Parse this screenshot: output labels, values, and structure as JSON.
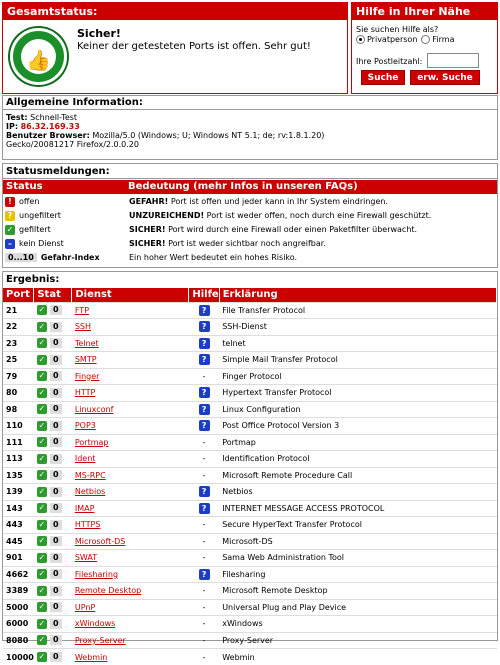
{
  "gesamtstatus": {
    "title": "Gesamtstatus:",
    "heading": "Sicher!",
    "message": "Keiner der getesteten Ports ist offen. Sehr gut!"
  },
  "hilfe": {
    "title": "Hilfe in Ihrer Nähe",
    "question": "Sie suchen Hilfe als?",
    "option_private": "Privatperson",
    "option_company": "Firma",
    "plz_label": "Ihre Postleitzahl:",
    "plz_value": "",
    "search_button": "Suche",
    "extended_button": "erw. Suche"
  },
  "info": {
    "title": "Allgemeine Information:",
    "test_label": "Test:",
    "test_value": "Schnell-Test",
    "ip_label": "IP:",
    "ip_value": "86.32.169.33",
    "browser_label": "Benutzer Browser:",
    "browser_value": "Mozilla/5.0 (Windows; U; Windows NT 5.1; de; rv:1.8.1.20)",
    "browser_value2": "Gecko/20081217 Firefox/2.0.0.20"
  },
  "statusmeldungen": {
    "title": "Statusmeldungen:",
    "col_status": "Status",
    "col_bedeutung": "Bedeutung (mehr Infos in unseren FAQs)",
    "rows": [
      {
        "label": "offen",
        "strong": "GEFAHR!",
        "text": "Port ist offen und jeder kann in Ihr System eindringen."
      },
      {
        "label": "ungefiltert",
        "strong": "UNZUREICHEND!",
        "text": "Port ist weder offen, noch durch eine Firewall geschützt."
      },
      {
        "label": "gefiltert",
        "strong": "SICHER!",
        "text": "Port wird durch eine Firewall oder einen Paketfilter überwacht."
      },
      {
        "label": "kein Dienst",
        "strong": "SICHER!",
        "text": "Port ist weder sichtbar noch angreifbar."
      },
      {
        "label": "Gefahr-Index",
        "gauge": "0...10",
        "strong": "",
        "text": "Ein hoher Wert bedeutet ein hohes Risiko."
      }
    ]
  },
  "ergebnis": {
    "title": "Ergebnis:",
    "columns": [
      "Port",
      "Stat",
      "Dienst",
      "Hilfe",
      "Erklärung"
    ],
    "rows": [
      {
        "port": "21",
        "index": "0",
        "dienst": "FTP",
        "hilfe": "?",
        "erklaerung": "File Transfer Protocol"
      },
      {
        "port": "22",
        "index": "0",
        "dienst": "SSH",
        "hilfe": "?",
        "erklaerung": "SSH-Dienst"
      },
      {
        "port": "23",
        "index": "0",
        "dienst": "Telnet",
        "hilfe": "?",
        "erklaerung": "telnet"
      },
      {
        "port": "25",
        "index": "0",
        "dienst": "SMTP",
        "hilfe": "?",
        "erklaerung": "Simple Mail Transfer Protocol"
      },
      {
        "port": "79",
        "index": "0",
        "dienst": "Finger",
        "hilfe": "-",
        "erklaerung": "Finger Protocol"
      },
      {
        "port": "80",
        "index": "0",
        "dienst": "HTTP",
        "hilfe": "?",
        "erklaerung": "Hypertext Transfer Protocol"
      },
      {
        "port": "98",
        "index": "0",
        "dienst": "Linuxconf",
        "hilfe": "?",
        "erklaerung": "Linux Configuration"
      },
      {
        "port": "110",
        "index": "0",
        "dienst": "POP3",
        "hilfe": "?",
        "erklaerung": "Post Office Protocol Version 3"
      },
      {
        "port": "111",
        "index": "0",
        "dienst": "Portmap",
        "hilfe": "-",
        "erklaerung": "Portmap"
      },
      {
        "port": "113",
        "index": "0",
        "dienst": "Ident",
        "hilfe": "-",
        "erklaerung": "Identification Protocol"
      },
      {
        "port": "135",
        "index": "0",
        "dienst": "MS-RPC",
        "hilfe": "-",
        "erklaerung": "Microsoft Remote Procedure Call"
      },
      {
        "port": "139",
        "index": "0",
        "dienst": "Netbios",
        "hilfe": "?",
        "erklaerung": "Netbios"
      },
      {
        "port": "143",
        "index": "0",
        "dienst": "IMAP",
        "hilfe": "?",
        "erklaerung": "INTERNET MESSAGE ACCESS PROTOCOL"
      },
      {
        "port": "443",
        "index": "0",
        "dienst": "HTTPS",
        "hilfe": "-",
        "erklaerung": "Secure HyperText Transfer Protocol"
      },
      {
        "port": "445",
        "index": "0",
        "dienst": "Microsoft-DS",
        "hilfe": "-",
        "erklaerung": "Microsoft-DS"
      },
      {
        "port": "901",
        "index": "0",
        "dienst": "SWAT",
        "hilfe": "-",
        "erklaerung": "Sama Web Administration Tool"
      },
      {
        "port": "4662",
        "index": "0",
        "dienst": "Filesharing",
        "hilfe": "?",
        "erklaerung": "Filesharing"
      },
      {
        "port": "3389",
        "index": "0",
        "dienst": "Remote Desktop",
        "hilfe": "-",
        "erklaerung": "Microsoft Remote Desktop"
      },
      {
        "port": "5000",
        "index": "0",
        "dienst": "UPnP",
        "hilfe": "-",
        "erklaerung": "Universal Plug and Play Device"
      },
      {
        "port": "6000",
        "index": "0",
        "dienst": "xWindows",
        "hilfe": "-",
        "erklaerung": "xWindows"
      },
      {
        "port": "8080",
        "index": "0",
        "dienst": "Proxy-Server",
        "hilfe": "-",
        "erklaerung": "Proxy-Server"
      },
      {
        "port": "10000",
        "index": "0",
        "dienst": "Webmin",
        "hilfe": "-",
        "erklaerung": "Webmin"
      }
    ]
  }
}
